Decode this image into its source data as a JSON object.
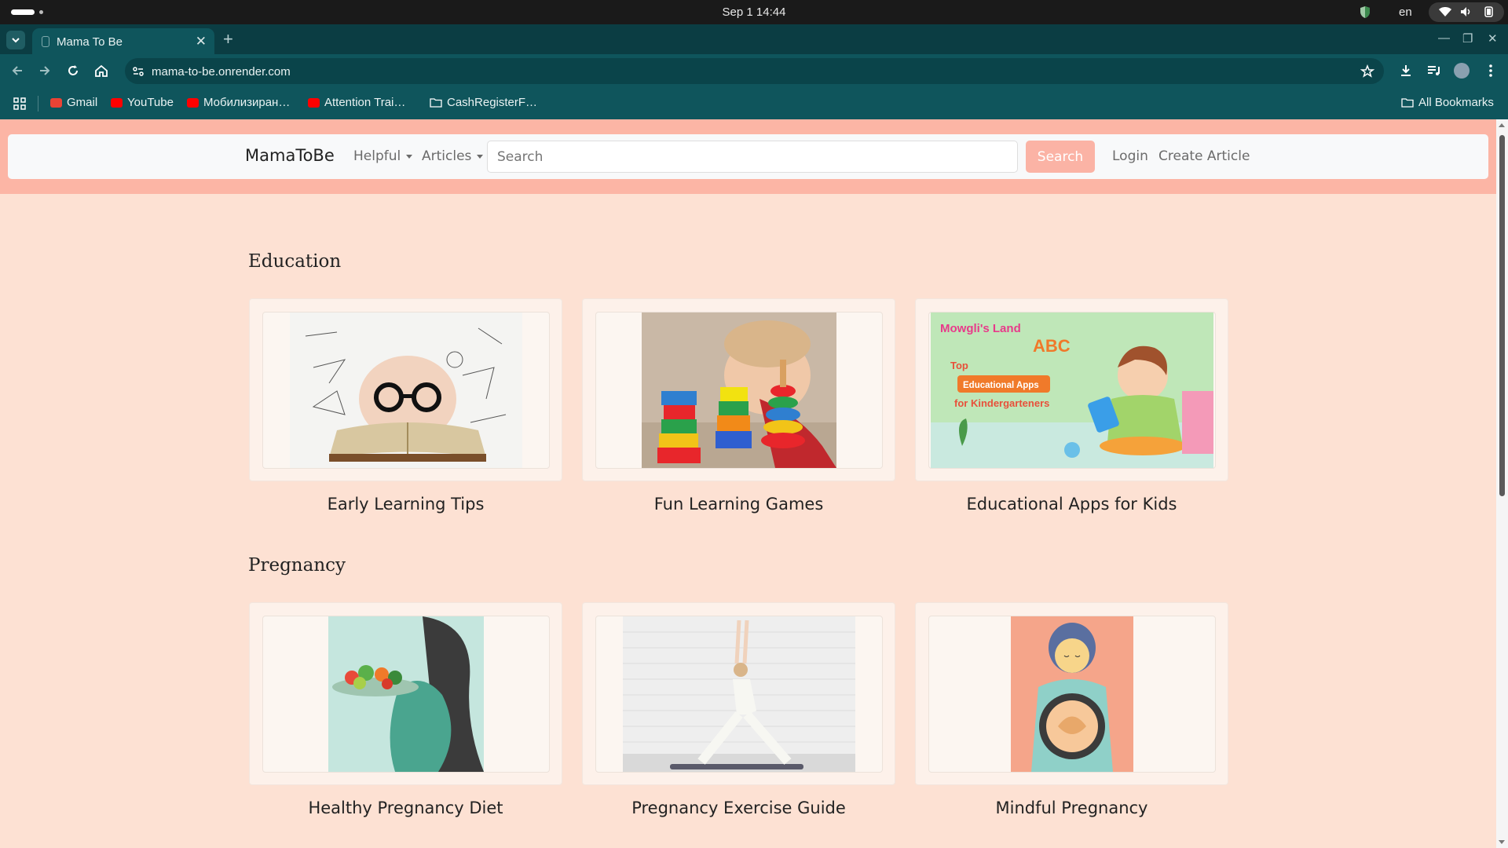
{
  "os": {
    "clock": "Sep 1  14:44",
    "lang": "en"
  },
  "browser": {
    "tab_title": "Mama To Be",
    "url": "mama-to-be.onrender.com",
    "bookmarks": [
      {
        "label": "Gmail",
        "icon": "gmail-icon",
        "color": "#ea4335"
      },
      {
        "label": "YouTube",
        "icon": "youtube-icon",
        "color": "#ff0000"
      },
      {
        "label": "Мобилизиран…",
        "icon": "youtube-icon",
        "color": "#ff0000"
      },
      {
        "label": "Attention Trai…",
        "icon": "youtube-icon",
        "color": "#ff0000"
      },
      {
        "label": "CashRegisterF…",
        "icon": "folder-icon",
        "color": "#eaf3f3"
      }
    ],
    "all_bookmarks": "All Bookmarks"
  },
  "navbar": {
    "brand": "MamaToBe",
    "helpful": "Helpful",
    "articles": "Articles",
    "search_placeholder": "Search",
    "search_button": "Search",
    "login": "Login",
    "create_article": "Create Article"
  },
  "sections": [
    {
      "title": "Education",
      "cards": [
        {
          "title": "Early Learning Tips",
          "image": "baby-with-glasses-reading-book"
        },
        {
          "title": "Fun Learning Games",
          "image": "baby-with-stacking-toys"
        },
        {
          "title": "Educational Apps for Kids",
          "image": "educational-apps-illustration",
          "image_text": [
            "Mowgli's Land",
            "ABC",
            "Top",
            "Educational Apps",
            "for Kindergarteners"
          ]
        }
      ]
    },
    {
      "title": "Pregnancy",
      "cards": [
        {
          "title": "Healthy Pregnancy Diet",
          "image": "pregnant-woman-with-salad"
        },
        {
          "title": "Pregnancy Exercise Guide",
          "image": "pregnant-woman-yoga"
        },
        {
          "title": "Mindful Pregnancy",
          "image": "pregnant-woman-illustration"
        }
      ]
    }
  ],
  "colors": {
    "page_bg": "#fde1d3",
    "header_band": "#fcb5a5",
    "search_button": "#fbb3a5",
    "browser_chrome": "#0f555c"
  }
}
